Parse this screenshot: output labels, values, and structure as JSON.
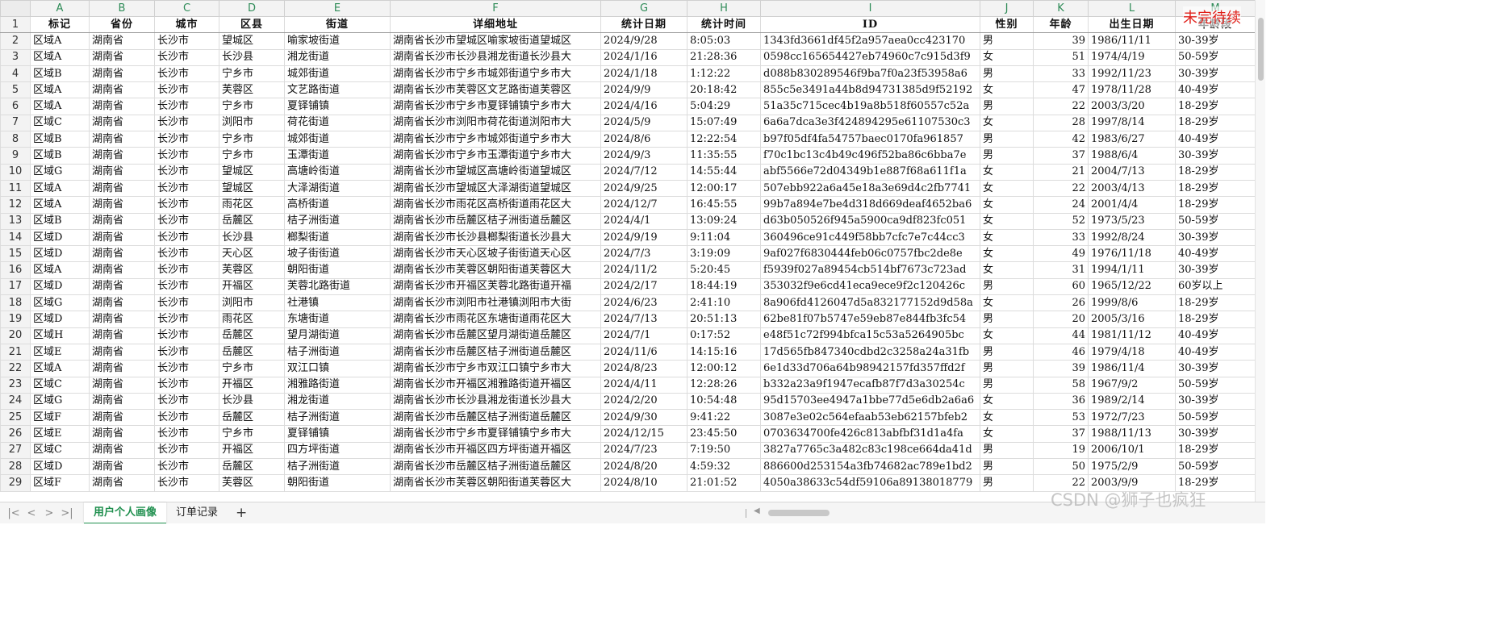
{
  "columns": [
    "A",
    "B",
    "C",
    "D",
    "E",
    "F",
    "G",
    "H",
    "I",
    "J",
    "K",
    "L",
    "M"
  ],
  "header_row_number": "1",
  "headers": [
    "标记",
    "省份",
    "城市",
    "区县",
    "街道",
    "详细地址",
    "统计日期",
    "统计时间",
    "ID",
    "性别",
    "年龄",
    "出生日期",
    "年龄段"
  ],
  "rows": [
    {
      "n": "2",
      "c": [
        "区域A",
        "湖南省",
        "长沙市",
        "望城区",
        "喻家坡街道",
        "湖南省长沙市望城区喻家坡街道望城区",
        "2024/9/28",
        "8:05:03",
        "1343fd3661df45f2a957aea0cc423170",
        "男",
        "39",
        "1986/11/11",
        "30-39岁"
      ]
    },
    {
      "n": "3",
      "c": [
        "区域A",
        "湖南省",
        "长沙市",
        "长沙县",
        "湘龙街道",
        "湖南省长沙市长沙县湘龙街道长沙县大",
        "2024/1/16",
        "21:28:36",
        "0598cc165654427eb74960c7c915d3f9",
        "女",
        "51",
        "1974/4/19",
        "50-59岁"
      ]
    },
    {
      "n": "4",
      "c": [
        "区域B",
        "湖南省",
        "长沙市",
        "宁乡市",
        "城郊街道",
        "湖南省长沙市宁乡市城郊街道宁乡市大",
        "2024/1/18",
        "1:12:22",
        "d088b830289546f9ba7f0a23f53958a6",
        "男",
        "33",
        "1992/11/23",
        "30-39岁"
      ]
    },
    {
      "n": "5",
      "c": [
        "区域A",
        "湖南省",
        "长沙市",
        "芙蓉区",
        "文艺路街道",
        "湖南省长沙市芙蓉区文艺路街道芙蓉区",
        "2024/9/9",
        "20:18:42",
        "855c5e3491a44b8d94731385d9f52192",
        "女",
        "47",
        "1978/11/28",
        "40-49岁"
      ]
    },
    {
      "n": "6",
      "c": [
        "区域A",
        "湖南省",
        "长沙市",
        "宁乡市",
        "夏铎铺镇",
        "湖南省长沙市宁乡市夏铎铺镇宁乡市大",
        "2024/4/16",
        "5:04:29",
        "51a35c715cec4b19a8b518f60557c52a",
        "男",
        "22",
        "2003/3/20",
        "18-29岁"
      ]
    },
    {
      "n": "7",
      "c": [
        "区域C",
        "湖南省",
        "长沙市",
        "浏阳市",
        "荷花街道",
        "湖南省长沙市浏阳市荷花街道浏阳市大",
        "2024/5/9",
        "15:07:49",
        "6a6a7dca3e3f424894295e61107530c3",
        "女",
        "28",
        "1997/8/14",
        "18-29岁"
      ]
    },
    {
      "n": "8",
      "c": [
        "区域B",
        "湖南省",
        "长沙市",
        "宁乡市",
        "城郊街道",
        "湖南省长沙市宁乡市城郊街道宁乡市大",
        "2024/8/6",
        "12:22:54",
        "b97f05df4fa54757baec0170fa961857",
        "男",
        "42",
        "1983/6/27",
        "40-49岁"
      ]
    },
    {
      "n": "9",
      "c": [
        "区域B",
        "湖南省",
        "长沙市",
        "宁乡市",
        "玉潭街道",
        "湖南省长沙市宁乡市玉潭街道宁乡市大",
        "2024/9/3",
        "11:35:55",
        "f70c1bc13c4b49c496f52ba86c6bba7e",
        "男",
        "37",
        "1988/6/4",
        "30-39岁"
      ]
    },
    {
      "n": "10",
      "c": [
        "区域G",
        "湖南省",
        "长沙市",
        "望城区",
        "高塘岭街道",
        "湖南省长沙市望城区高塘岭街道望城区",
        "2024/7/12",
        "14:55:44",
        "abf5566e72d04349b1e887f68a611f1a",
        "女",
        "21",
        "2004/7/13",
        "18-29岁"
      ]
    },
    {
      "n": "11",
      "c": [
        "区域A",
        "湖南省",
        "长沙市",
        "望城区",
        "大泽湖街道",
        "湖南省长沙市望城区大泽湖街道望城区",
        "2024/9/25",
        "12:00:17",
        "507ebb922a6a45e18a3e69d4c2fb7741",
        "女",
        "22",
        "2003/4/13",
        "18-29岁"
      ]
    },
    {
      "n": "12",
      "c": [
        "区域A",
        "湖南省",
        "长沙市",
        "雨花区",
        "高桥街道",
        "湖南省长沙市雨花区高桥街道雨花区大",
        "2024/12/7",
        "16:45:55",
        "99b7a894e7be4d318d669deaf4652ba6",
        "女",
        "24",
        "2001/4/4",
        "18-29岁"
      ]
    },
    {
      "n": "13",
      "c": [
        "区域B",
        "湖南省",
        "长沙市",
        "岳麓区",
        "桔子洲街道",
        "湖南省长沙市岳麓区桔子洲街道岳麓区",
        "2024/4/1",
        "13:09:24",
        "d63b050526f945a5900ca9df823fc051",
        "女",
        "52",
        "1973/5/23",
        "50-59岁"
      ]
    },
    {
      "n": "14",
      "c": [
        "区域D",
        "湖南省",
        "长沙市",
        "长沙县",
        "榔梨街道",
        "湖南省长沙市长沙县榔梨街道长沙县大",
        "2024/9/19",
        "9:11:04",
        "360496ce91c449f58bb7cfc7e7c44cc3",
        "女",
        "33",
        "1992/8/24",
        "30-39岁"
      ]
    },
    {
      "n": "15",
      "c": [
        "区域D",
        "湖南省",
        "长沙市",
        "天心区",
        "坡子街街道",
        "湖南省长沙市天心区坡子街街道天心区",
        "2024/7/3",
        "3:19:09",
        "9af027f6830444feb06c0757fbc2de8e",
        "女",
        "49",
        "1976/11/18",
        "40-49岁"
      ]
    },
    {
      "n": "16",
      "c": [
        "区域A",
        "湖南省",
        "长沙市",
        "芙蓉区",
        "朝阳街道",
        "湖南省长沙市芙蓉区朝阳街道芙蓉区大",
        "2024/11/2",
        "5:20:45",
        "f5939f027a89454cb514bf7673c723ad",
        "女",
        "31",
        "1994/1/11",
        "30-39岁"
      ]
    },
    {
      "n": "17",
      "c": [
        "区域D",
        "湖南省",
        "长沙市",
        "开福区",
        "芙蓉北路街道",
        "湖南省长沙市开福区芙蓉北路街道开福",
        "2024/2/17",
        "18:44:19",
        "353032f9e6cd41eca9ece9f2c120426c",
        "男",
        "60",
        "1965/12/22",
        "60岁以上"
      ]
    },
    {
      "n": "18",
      "c": [
        "区域G",
        "湖南省",
        "长沙市",
        "浏阳市",
        "社港镇",
        "湖南省长沙市浏阳市社港镇浏阳市大街",
        "2024/6/23",
        "2:41:10",
        "8a906fd4126047d5a832177152d9d58a",
        "女",
        "26",
        "1999/8/6",
        "18-29岁"
      ]
    },
    {
      "n": "19",
      "c": [
        "区域D",
        "湖南省",
        "长沙市",
        "雨花区",
        "东塘街道",
        "湖南省长沙市雨花区东塘街道雨花区大",
        "2024/7/13",
        "20:51:13",
        "62be81f07b5747e59eb87e844fb3fc54",
        "男",
        "20",
        "2005/3/16",
        "18-29岁"
      ]
    },
    {
      "n": "20",
      "c": [
        "区域H",
        "湖南省",
        "长沙市",
        "岳麓区",
        "望月湖街道",
        "湖南省长沙市岳麓区望月湖街道岳麓区",
        "2024/7/1",
        "0:17:52",
        "e48f51c72f994bfca15c53a5264905bc",
        "女",
        "44",
        "1981/11/12",
        "40-49岁"
      ]
    },
    {
      "n": "21",
      "c": [
        "区域E",
        "湖南省",
        "长沙市",
        "岳麓区",
        "桔子洲街道",
        "湖南省长沙市岳麓区桔子洲街道岳麓区",
        "2024/11/6",
        "14:15:16",
        "17d565fb847340cdbd2c3258a24a31fb",
        "男",
        "46",
        "1979/4/18",
        "40-49岁"
      ]
    },
    {
      "n": "22",
      "c": [
        "区域A",
        "湖南省",
        "长沙市",
        "宁乡市",
        "双江口镇",
        "湖南省长沙市宁乡市双江口镇宁乡市大",
        "2024/8/23",
        "12:00:12",
        "6e1d33d706a64b98942157fd357ffd2f",
        "男",
        "39",
        "1986/11/4",
        "30-39岁"
      ]
    },
    {
      "n": "23",
      "c": [
        "区域C",
        "湖南省",
        "长沙市",
        "开福区",
        "湘雅路街道",
        "湖南省长沙市开福区湘雅路街道开福区",
        "2024/4/11",
        "12:28:26",
        "b332a23a9f1947ecafb87f7d3a30254c",
        "男",
        "58",
        "1967/9/2",
        "50-59岁"
      ]
    },
    {
      "n": "24",
      "c": [
        "区域G",
        "湖南省",
        "长沙市",
        "长沙县",
        "湘龙街道",
        "湖南省长沙市长沙县湘龙街道长沙县大",
        "2024/2/20",
        "10:54:48",
        "95d15703ee4947a1bbe77d5e6db2a6a6",
        "女",
        "36",
        "1989/2/14",
        "30-39岁"
      ]
    },
    {
      "n": "25",
      "c": [
        "区域F",
        "湖南省",
        "长沙市",
        "岳麓区",
        "桔子洲街道",
        "湖南省长沙市岳麓区桔子洲街道岳麓区",
        "2024/9/30",
        "9:41:22",
        "3087e3e02c564efaab53eb62157bfeb2",
        "女",
        "53",
        "1972/7/23",
        "50-59岁"
      ]
    },
    {
      "n": "26",
      "c": [
        "区域E",
        "湖南省",
        "长沙市",
        "宁乡市",
        "夏铎铺镇",
        "湖南省长沙市宁乡市夏铎铺镇宁乡市大",
        "2024/12/15",
        "23:45:50",
        "0703634700fe426c813abfbf31d1a4fa",
        "女",
        "37",
        "1988/11/13",
        "30-39岁"
      ]
    },
    {
      "n": "27",
      "c": [
        "区域C",
        "湖南省",
        "长沙市",
        "开福区",
        "四方坪街道",
        "湖南省长沙市开福区四方坪街道开福区",
        "2024/7/23",
        "7:19:50",
        "3827a7765c3a482c83c198ce664da41d",
        "男",
        "19",
        "2006/10/1",
        "18-29岁"
      ]
    },
    {
      "n": "28",
      "c": [
        "区域D",
        "湖南省",
        "长沙市",
        "岳麓区",
        "桔子洲街道",
        "湖南省长沙市岳麓区桔子洲街道岳麓区",
        "2024/8/20",
        "4:59:32",
        "886600d253154a3fb74682ac789e1bd2",
        "男",
        "50",
        "1975/2/9",
        "50-59岁"
      ]
    },
    {
      "n": "29",
      "c": [
        "区域F",
        "湖南省",
        "长沙市",
        "芙蓉区",
        "朝阳街道",
        "湖南省长沙市芙蓉区朝阳街道芙蓉区大",
        "2024/8/10",
        "21:01:52",
        "4050a38633c54df59106a89138018779",
        "男",
        "22",
        "2003/9/9",
        "18-29岁"
      ]
    }
  ],
  "sheet_tabs": [
    "用户个人画像",
    "订单记录"
  ],
  "add_sheet": "+",
  "nav": [
    "|<",
    "<",
    ">",
    ">|"
  ],
  "stamp_text": "未完待续",
  "watermark_text": "CSDN @狮子也疯狂",
  "accent_color": "#1f8f4e"
}
